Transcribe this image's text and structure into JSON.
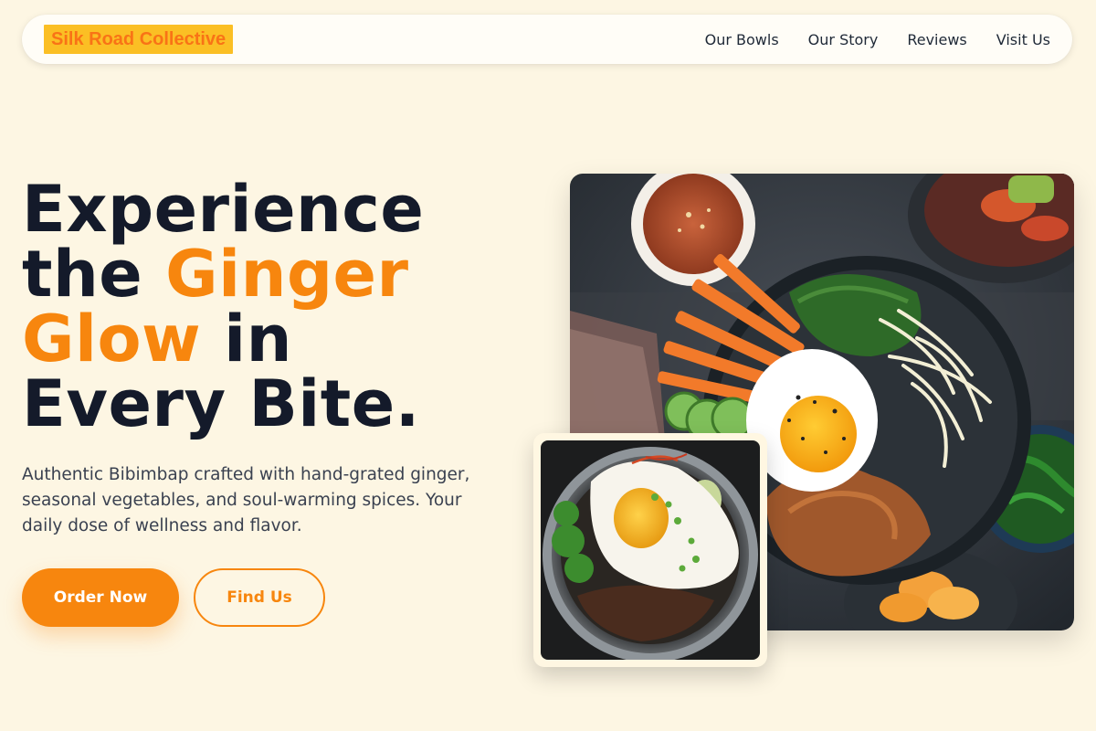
{
  "brand": {
    "name": "Silk Road Collective"
  },
  "nav": {
    "links": [
      "Our Bowls",
      "Our Story",
      "Reviews",
      "Visit Us"
    ]
  },
  "hero": {
    "headline_line1": "Experience",
    "headline_line2_plain": "the ",
    "headline_line2_accent": "Ginger",
    "headline_line3_accent": "Glow",
    "headline_line3_plain": " in",
    "headline_line4": "Every Bite.",
    "description": "Authentic Bibimbap crafted with hand-grated ginger, seasonal vegetables, and soul-warming spices. Your daily dose of wellness and flavor.",
    "primary_cta": "Order Now",
    "secondary_cta": "Find Us"
  },
  "images": {
    "main_icon": "bibimbap-bowl-photo",
    "inset_icon": "stone-pot-bibimbap-photo"
  },
  "colors": {
    "background": "#fdf6e3",
    "accent": "#f7860e",
    "logo_bg": "#fbbf24",
    "headline": "#141a2a",
    "body_text": "#3a4150"
  }
}
